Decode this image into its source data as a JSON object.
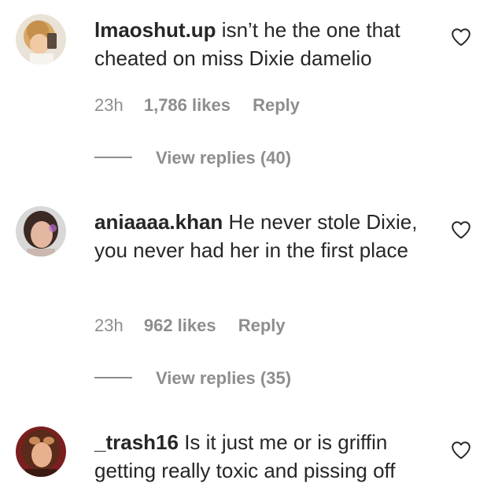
{
  "comments": [
    {
      "username": "lmaoshut.up",
      "text": " isn’t he the one that cheated on miss Dixie damelio",
      "time": "23h",
      "likes": "1,786 likes",
      "reply": "Reply",
      "view_replies": "View replies (40)",
      "avatar_icon": "avatar-photo"
    },
    {
      "username": "aniaaaa.khan",
      "text": " He never stole Dixie, you never had her in the first place",
      "time": "23h",
      "likes": "962 likes",
      "reply": "Reply",
      "view_replies": "View replies (35)",
      "avatar_icon": "avatar-photo"
    },
    {
      "username": "_trash16",
      "text": " Is it just me or is griffin getting really toxic and pissing off",
      "avatar_icon": "avatar-photo"
    }
  ],
  "icons": {
    "like": "heart-outline-icon"
  },
  "colors": {
    "text": "#262626",
    "secondary": "#8e8e8e",
    "background": "#ffffff"
  }
}
